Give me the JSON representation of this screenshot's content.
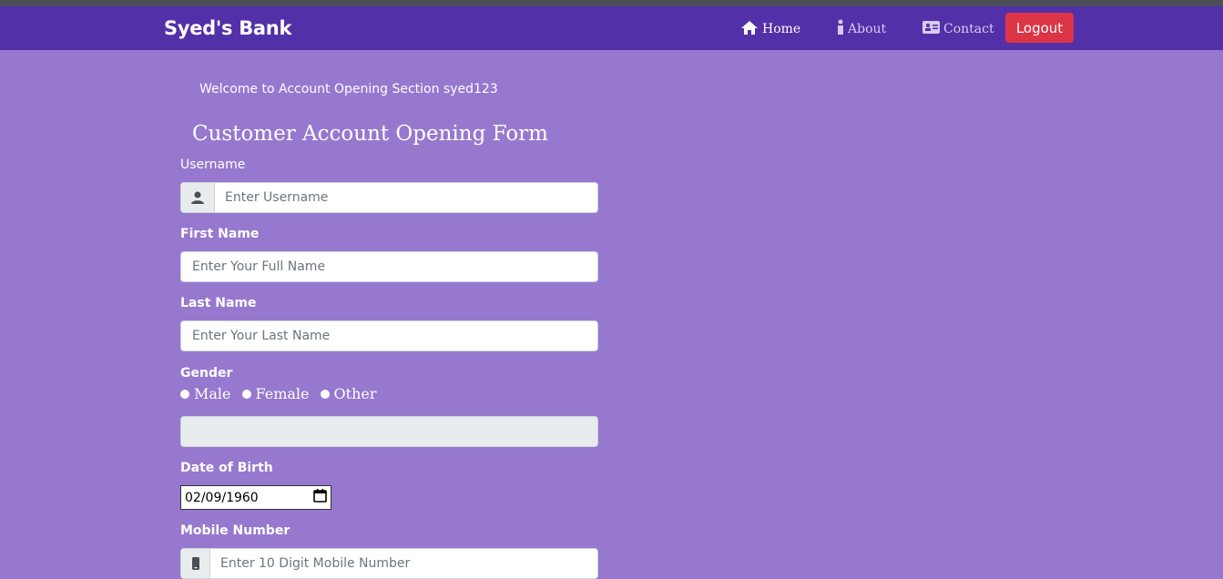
{
  "nav": {
    "brand": "Syed's Bank",
    "home": "Home",
    "about": "About",
    "contact": "Contact",
    "logout": "Logout"
  },
  "page": {
    "welcome": "Welcome to Account Opening Section syed123",
    "form_title": "Customer Account Opening Form"
  },
  "form": {
    "username_label": "Username",
    "username_placeholder": "Enter Username",
    "first_name_label": "First Name",
    "first_name_placeholder": "Enter Your Full Name",
    "last_name_label": "Last Name",
    "last_name_placeholder": "Enter Your Last Name",
    "gender_label": "Gender",
    "gender_options": [
      "Male",
      "Female",
      "Other"
    ],
    "dob_label": "Date of Birth",
    "dob_value": "02/09/1960",
    "mobile_label": "Mobile Number",
    "mobile_placeholder": "Enter 10 Digit Mobile Number"
  },
  "colors": {
    "navbar": "#5230a8",
    "background": "#9678cf",
    "logout": "#dc3545"
  },
  "icons": {
    "home": "home-icon",
    "about": "info-icon",
    "contact": "id-card-icon",
    "username": "user-icon",
    "mobile": "mobile-phone-icon",
    "calendar": "calendar-icon"
  }
}
